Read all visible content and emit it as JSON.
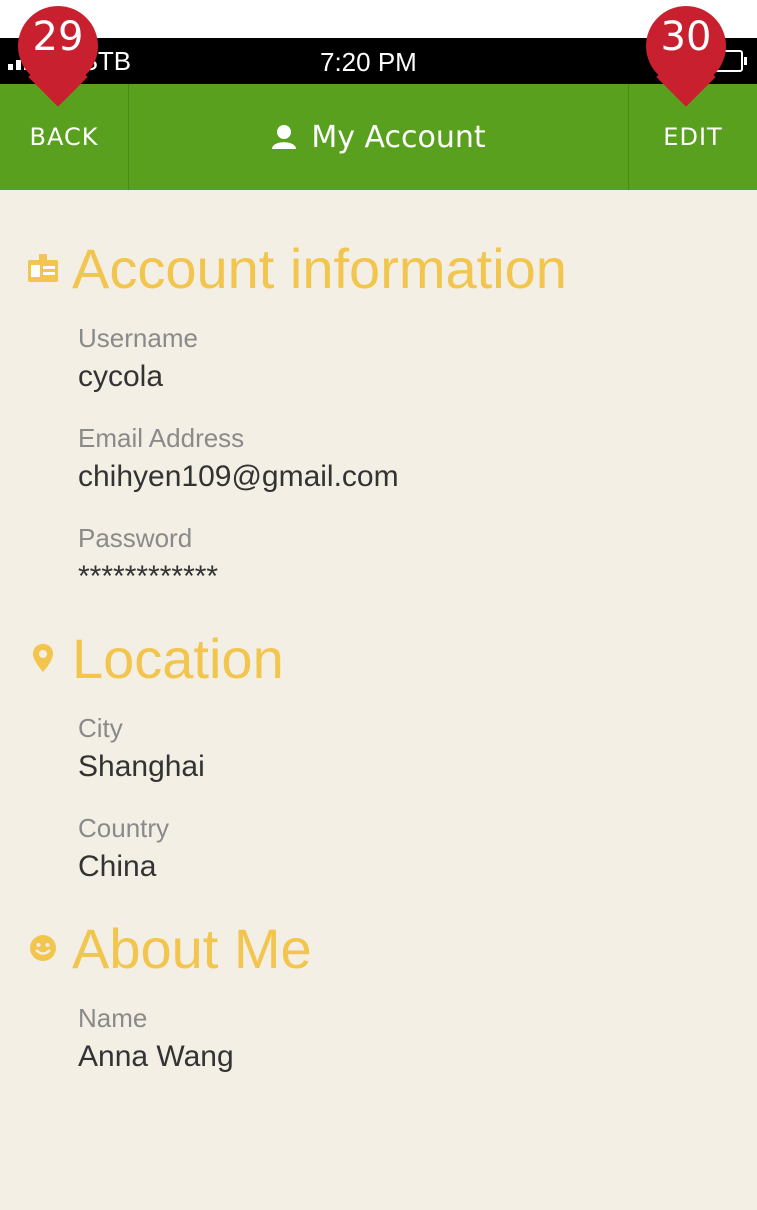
{
  "status_bar": {
    "carrier": "V-STB",
    "time": "7:20 PM"
  },
  "nav": {
    "back_label": "BACK",
    "title": "My Account",
    "edit_label": "EDIT"
  },
  "markers": [
    {
      "number": "29"
    },
    {
      "number": "30"
    }
  ],
  "sections": {
    "account": {
      "title": "Account information",
      "username_label": "Username",
      "username_value": "cycola",
      "email_label": "Email Address",
      "email_value": "chihyen109@gmail.com",
      "password_label": "Password",
      "password_value": "************"
    },
    "location": {
      "title": "Location",
      "city_label": "City",
      "city_value": "Shanghai",
      "country_label": "Country",
      "country_value": "China"
    },
    "about": {
      "title": "About Me",
      "name_label": "Name",
      "name_value": "Anna Wang"
    }
  },
  "colors": {
    "nav_green": "#58a01e",
    "heading_yellow": "#f2c54e",
    "background": "#f4efe5",
    "marker_red": "#c8202f"
  }
}
